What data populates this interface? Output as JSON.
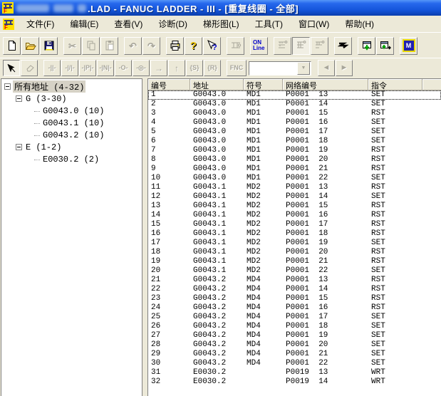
{
  "window": {
    "title": ".LAD - FANUC LADDER - III - [重复线圈 - 全部]",
    "app_name": "FANUC LADDER - III",
    "document_view": "重复线圈 - 全部"
  },
  "colors": {
    "chrome": "#ECE9D8",
    "titlebar_top": "#5596F8",
    "titlebar_bottom": "#0A3EAC",
    "accent_blue": "#0000CC",
    "selection_gray": "#D6D2C6"
  },
  "menu": {
    "items": [
      "文件(F)",
      "编辑(E)",
      "查看(V)",
      "诊断(D)",
      "梯形图(L)",
      "工具(T)",
      "窗口(W)",
      "帮助(H)"
    ]
  },
  "toolbar_main": {
    "online_top": "ON",
    "online_bottom": "Line",
    "mnemonic_label": "M"
  },
  "toolbar_edit": {
    "symbols": [
      "-||-",
      "-|/|-",
      "-|P|-",
      "-|N|-",
      "-O-",
      "-◎-",
      "→",
      "↑",
      "{S}",
      "{R}",
      "FNC"
    ],
    "combo_value": "",
    "prev_glyph": "◄",
    "next_glyph": "►"
  },
  "tree": {
    "root_label": "所有地址 (4-32)",
    "groups": [
      {
        "label": "G (3-30)",
        "children": [
          "G0043.0 (10)",
          "G0043.1 (10)",
          "G0043.2 (10)"
        ]
      },
      {
        "label": "E (1-2)",
        "children": [
          "E0030.2 (2)"
        ]
      }
    ]
  },
  "table": {
    "columns": [
      "编号",
      "地址",
      "符号",
      "网络编号",
      "指令"
    ],
    "rows": [
      [
        "1",
        "G0043.0",
        "MD1",
        "P0001  13",
        "SET"
      ],
      [
        "2",
        "G0043.0",
        "MD1",
        "P0001  14",
        "SET"
      ],
      [
        "3",
        "G0043.0",
        "MD1",
        "P0001  15",
        "RST"
      ],
      [
        "4",
        "G0043.0",
        "MD1",
        "P0001  16",
        "SET"
      ],
      [
        "5",
        "G0043.0",
        "MD1",
        "P0001  17",
        "SET"
      ],
      [
        "6",
        "G0043.0",
        "MD1",
        "P0001  18",
        "SET"
      ],
      [
        "7",
        "G0043.0",
        "MD1",
        "P0001  19",
        "RST"
      ],
      [
        "8",
        "G0043.0",
        "MD1",
        "P0001  20",
        "RST"
      ],
      [
        "9",
        "G0043.0",
        "MD1",
        "P0001  21",
        "RST"
      ],
      [
        "10",
        "G0043.0",
        "MD1",
        "P0001  22",
        "SET"
      ],
      [
        "11",
        "G0043.1",
        "MD2",
        "P0001  13",
        "RST"
      ],
      [
        "12",
        "G0043.1",
        "MD2",
        "P0001  14",
        "SET"
      ],
      [
        "13",
        "G0043.1",
        "MD2",
        "P0001  15",
        "RST"
      ],
      [
        "14",
        "G0043.1",
        "MD2",
        "P0001  16",
        "RST"
      ],
      [
        "15",
        "G0043.1",
        "MD2",
        "P0001  17",
        "RST"
      ],
      [
        "16",
        "G0043.1",
        "MD2",
        "P0001  18",
        "RST"
      ],
      [
        "17",
        "G0043.1",
        "MD2",
        "P0001  19",
        "SET"
      ],
      [
        "18",
        "G0043.1",
        "MD2",
        "P0001  20",
        "RST"
      ],
      [
        "19",
        "G0043.1",
        "MD2",
        "P0001  21",
        "RST"
      ],
      [
        "20",
        "G0043.1",
        "MD2",
        "P0001  22",
        "SET"
      ],
      [
        "21",
        "G0043.2",
        "MD4",
        "P0001  13",
        "RST"
      ],
      [
        "22",
        "G0043.2",
        "MD4",
        "P0001  14",
        "RST"
      ],
      [
        "23",
        "G0043.2",
        "MD4",
        "P0001  15",
        "RST"
      ],
      [
        "24",
        "G0043.2",
        "MD4",
        "P0001  16",
        "RST"
      ],
      [
        "25",
        "G0043.2",
        "MD4",
        "P0001  17",
        "SET"
      ],
      [
        "26",
        "G0043.2",
        "MD4",
        "P0001  18",
        "SET"
      ],
      [
        "27",
        "G0043.2",
        "MD4",
        "P0001  19",
        "SET"
      ],
      [
        "28",
        "G0043.2",
        "MD4",
        "P0001  20",
        "SET"
      ],
      [
        "29",
        "G0043.2",
        "MD4",
        "P0001  21",
        "SET"
      ],
      [
        "30",
        "G0043.2",
        "MD4",
        "P0001  22",
        "SET"
      ],
      [
        "31",
        "E0030.2",
        "",
        "P0019  13",
        "WRT"
      ],
      [
        "32",
        "E0030.2",
        "",
        "P0019  14",
        "WRT"
      ]
    ]
  }
}
